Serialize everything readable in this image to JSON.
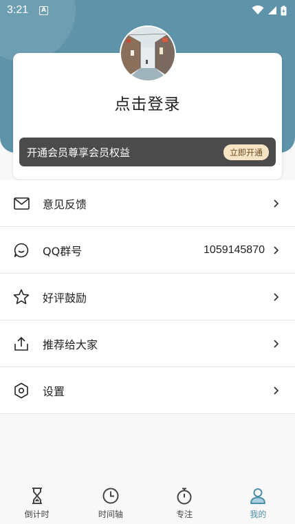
{
  "status_bar": {
    "time": "3:21",
    "notification_icon": "A"
  },
  "profile": {
    "login_text": "点击登录",
    "avatar": "street-photo-avatar"
  },
  "vip": {
    "text": "开通会员尊享会员权益",
    "button": "立即开通"
  },
  "menu": [
    {
      "icon": "mail-icon",
      "label": "意见反馈",
      "value": ""
    },
    {
      "icon": "chat-icon",
      "label": "QQ群号",
      "value": "1059145870"
    },
    {
      "icon": "star-icon",
      "label": "好评鼓励",
      "value": ""
    },
    {
      "icon": "share-icon",
      "label": "推荐给大家",
      "value": ""
    },
    {
      "icon": "settings-icon",
      "label": "设置",
      "value": ""
    }
  ],
  "tabs": [
    {
      "icon": "hourglass-icon",
      "label": "倒计时"
    },
    {
      "icon": "clock-icon",
      "label": "时间轴"
    },
    {
      "icon": "stopwatch-icon",
      "label": "专注"
    },
    {
      "icon": "person-icon",
      "label": "我的",
      "active": true
    }
  ],
  "colors": {
    "header": "#5e93aa",
    "accent": "#4e8ea6",
    "vip_bar": "#4b4b4b",
    "vip_button": "#f7e4c4"
  }
}
